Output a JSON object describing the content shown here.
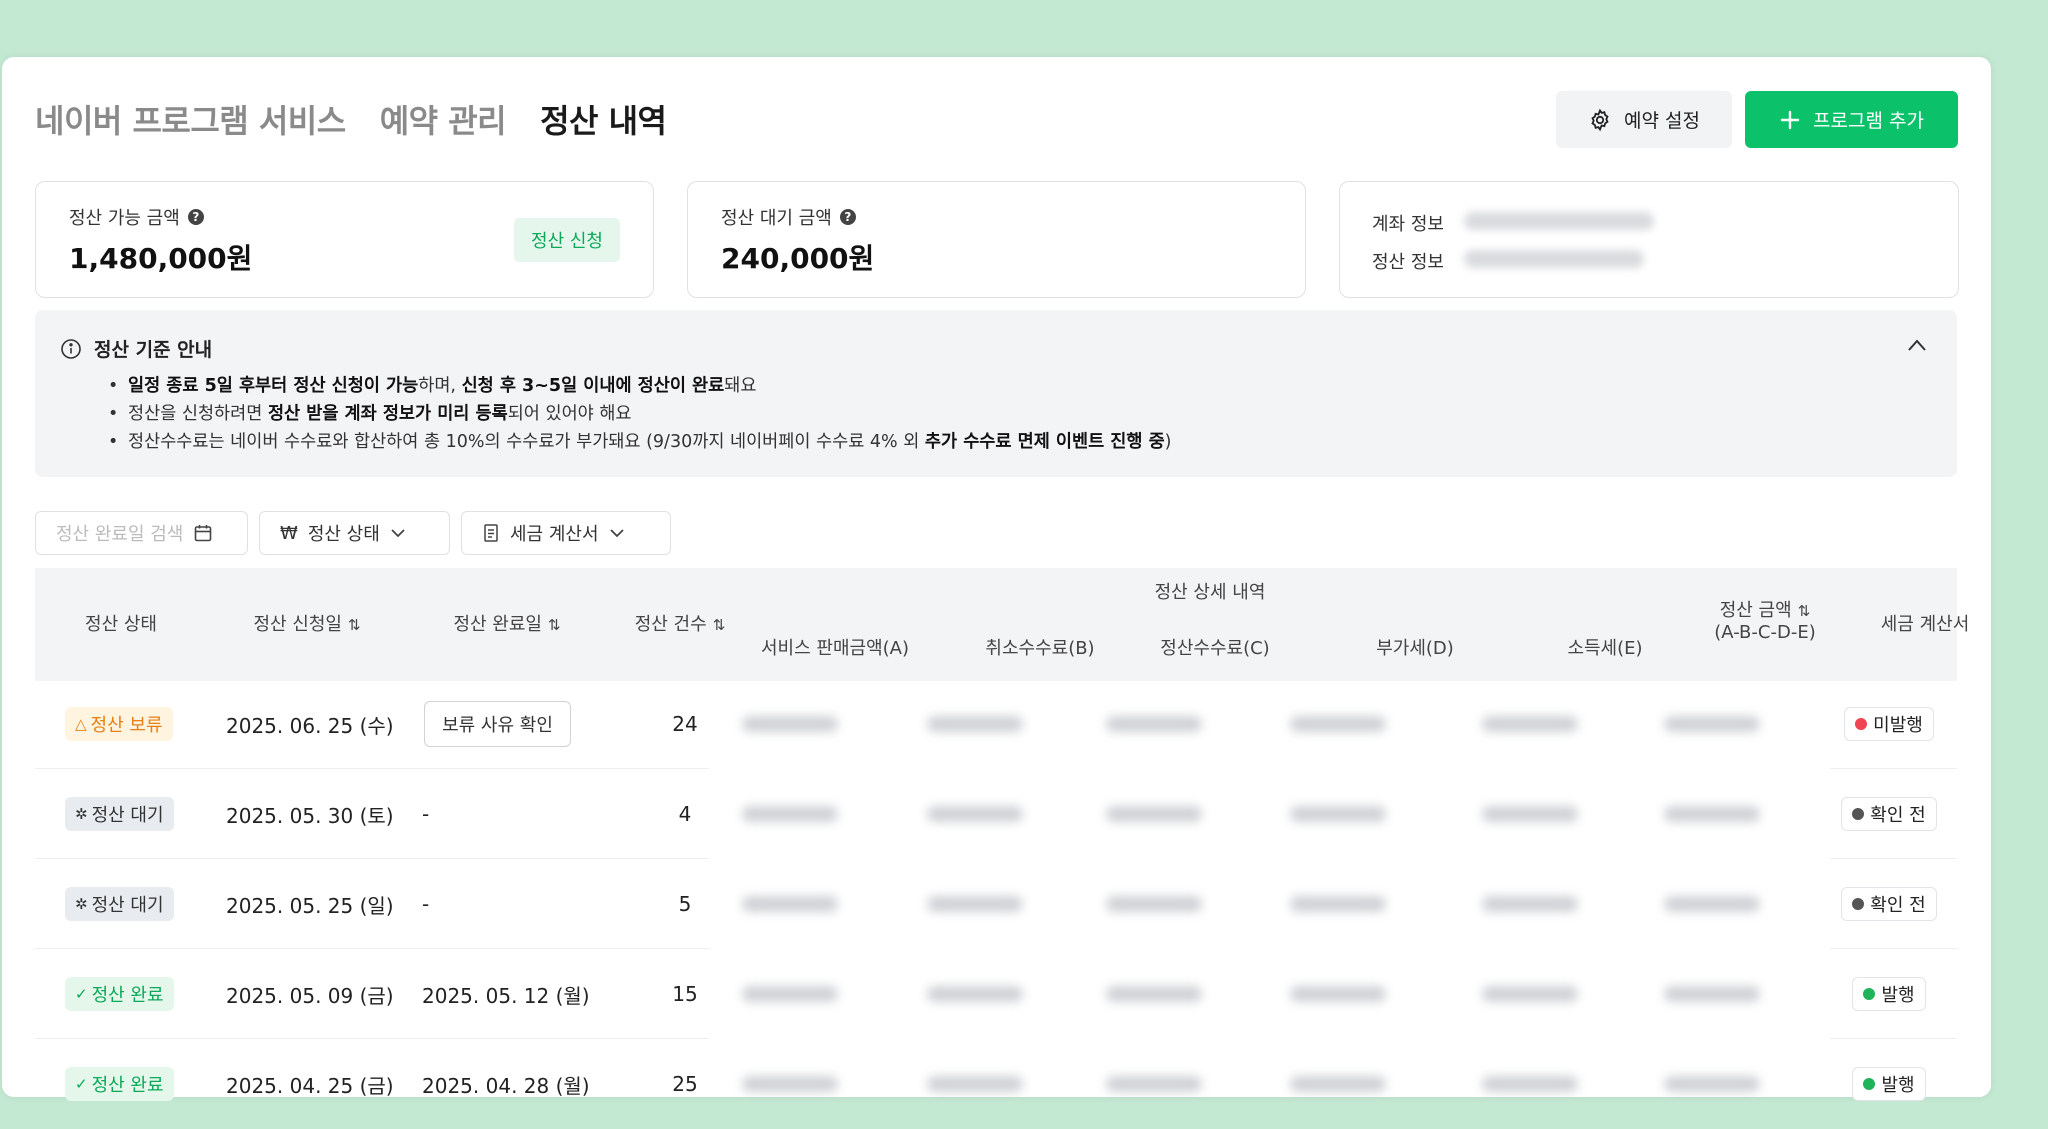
{
  "header": {
    "tabs": [
      {
        "label": "네이버 프로그램 서비스",
        "active": false
      },
      {
        "label": "예약 관리",
        "active": false
      },
      {
        "label": "정산 내역",
        "active": true
      }
    ],
    "settings_button": "예약 설정",
    "add_button": "프로그램 추가"
  },
  "summary": {
    "available_label": "정산 가능 금액",
    "available_amount": "1,480,000원",
    "apply_button": "정산 신청",
    "pending_label": "정산 대기 금액",
    "pending_amount": "240,000원",
    "account_label": "계좌 정보",
    "settlement_label": "정산 정보"
  },
  "notice": {
    "title": "정산 기준 안내",
    "items": [
      [
        "일정 종료 5일 후부터 정산 신청이 가능",
        "하며, ",
        "신청 후 3~5일 이내에 정산이 완료",
        "돼요"
      ],
      [
        "정산을 신청하려면 ",
        "정산 받을 계좌 정보가 미리 등록",
        "되어 있어야 해요"
      ],
      [
        "정산수수료는 네이버 수수료와 합산하여 총 10%의 수수료가 부가돼요 (9/30까지 네이버페이 수수료 4% 외 ",
        "추가 수수료 면제 이벤트 진행 중",
        ")"
      ]
    ]
  },
  "filters": {
    "date_placeholder": "정산 완료일 검색",
    "status_label": "정산 상태",
    "tax_label": "세금 계산서"
  },
  "table": {
    "headers": {
      "status": "정산 상태",
      "request_date": "정산 신청일",
      "complete_date": "정산 완료일",
      "count": "정산 건수",
      "detail_group": "정산 상세 내역",
      "sales": "서비스 판매금액(A)",
      "cancel_fee": "취소수수료(B)",
      "settle_fee": "정산수수료(C)",
      "vat": "부가세(D)",
      "income_tax": "소득세(E)",
      "amount": "정산 금액",
      "amount_formula": "(A-B-C-D-E)",
      "tax_invoice": "세금 계산서"
    },
    "rows": [
      {
        "status": "정산 보류",
        "status_type": "hold",
        "request_date": "2025. 06. 25 (수)",
        "complete_date": "보류 사유 확인",
        "complete_is_button": true,
        "count": "24",
        "tax": "미발행",
        "tax_color": "#f04452"
      },
      {
        "status": "정산 대기",
        "status_type": "wait",
        "request_date": "2025. 05. 30 (토)",
        "complete_date": "-",
        "complete_is_button": false,
        "count": "4",
        "tax": "확인 전",
        "tax_color": "#555555"
      },
      {
        "status": "정산 대기",
        "status_type": "wait",
        "request_date": "2025. 05. 25 (일)",
        "complete_date": "-",
        "complete_is_button": false,
        "count": "5",
        "tax": "확인 전",
        "tax_color": "#555555"
      },
      {
        "status": "정산 완료",
        "status_type": "done",
        "request_date": "2025. 05. 09 (금)",
        "complete_date": "2025. 05. 12 (월)",
        "complete_is_button": false,
        "count": "15",
        "tax": "발행",
        "tax_color": "#1fb45a"
      },
      {
        "status": "정산 완료",
        "status_type": "done",
        "request_date": "2025. 04. 25 (금)",
        "complete_date": "2025. 04. 28 (월)",
        "complete_is_button": false,
        "count": "25",
        "tax": "발행",
        "tax_color": "#1fb45a"
      }
    ]
  },
  "colors": {
    "brand_green": "#0bc26a",
    "background": "#c4e9d3"
  }
}
